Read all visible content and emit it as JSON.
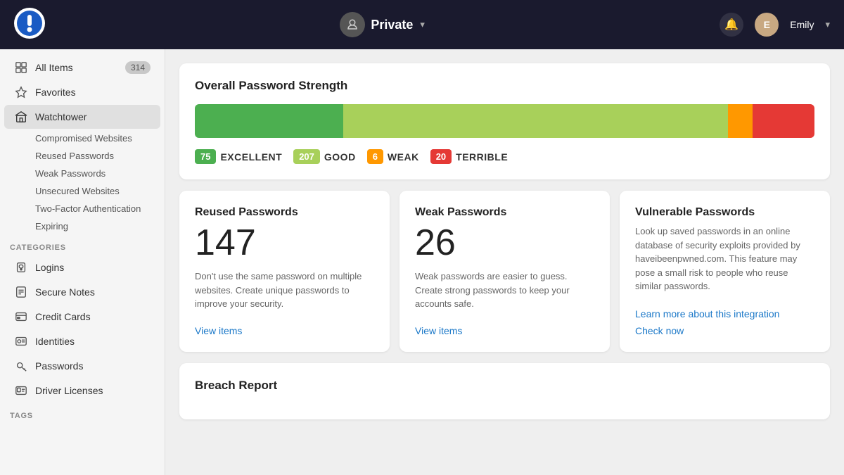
{
  "header": {
    "vault_icon": "🔒",
    "vault_name": "Private",
    "bell_icon": "🔔",
    "user_initial": "E",
    "user_name": "Emily",
    "chevron": "▾"
  },
  "sidebar": {
    "all_items_label": "All Items",
    "all_items_count": "314",
    "favorites_label": "Favorites",
    "watchtower_label": "Watchtower",
    "compromised_label": "Compromised Websites",
    "reused_label": "Reused Passwords",
    "weak_label": "Weak Passwords",
    "unsecured_label": "Unsecured Websites",
    "twofactor_label": "Two-Factor Authentication",
    "expiring_label": "Expiring",
    "categories_label": "CATEGORIES",
    "logins_label": "Logins",
    "secure_notes_label": "Secure Notes",
    "credit_cards_label": "Credit Cards",
    "identities_label": "Identities",
    "passwords_label": "Passwords",
    "driver_licenses_label": "Driver Licenses",
    "tags_label": "TAGS"
  },
  "main": {
    "password_strength": {
      "title": "Overall Password Strength",
      "bar": {
        "excellent_pct": 24,
        "good_pct": 62,
        "weak_pct": 4,
        "terrible_pct": 10
      },
      "legend": [
        {
          "count": "75",
          "label": "EXCELLENT",
          "color": "#4caf50"
        },
        {
          "count": "207",
          "label": "GOOD",
          "color": "#a8d05a"
        },
        {
          "count": "6",
          "label": "WEAK",
          "color": "#ff9800"
        },
        {
          "count": "20",
          "label": "TERRIBLE",
          "color": "#e53935"
        }
      ]
    },
    "stat_cards": [
      {
        "title": "Reused Passwords",
        "number": "147",
        "desc": "Don't use the same password on multiple websites. Create unique passwords to improve your security.",
        "link": "View items"
      },
      {
        "title": "Weak Passwords",
        "number": "26",
        "desc": "Weak passwords are easier to guess. Create strong passwords to keep your accounts safe.",
        "link": "View items"
      },
      {
        "title": "Vulnerable Passwords",
        "number": null,
        "desc": "Look up saved passwords in an online database of security exploits provided by haveibeenpwned.com. This feature may pose a small risk to people who reuse similar passwords.",
        "link": "Learn more about this integration",
        "link2": "Check now"
      }
    ],
    "breach_report": {
      "title": "Breach Report"
    }
  }
}
